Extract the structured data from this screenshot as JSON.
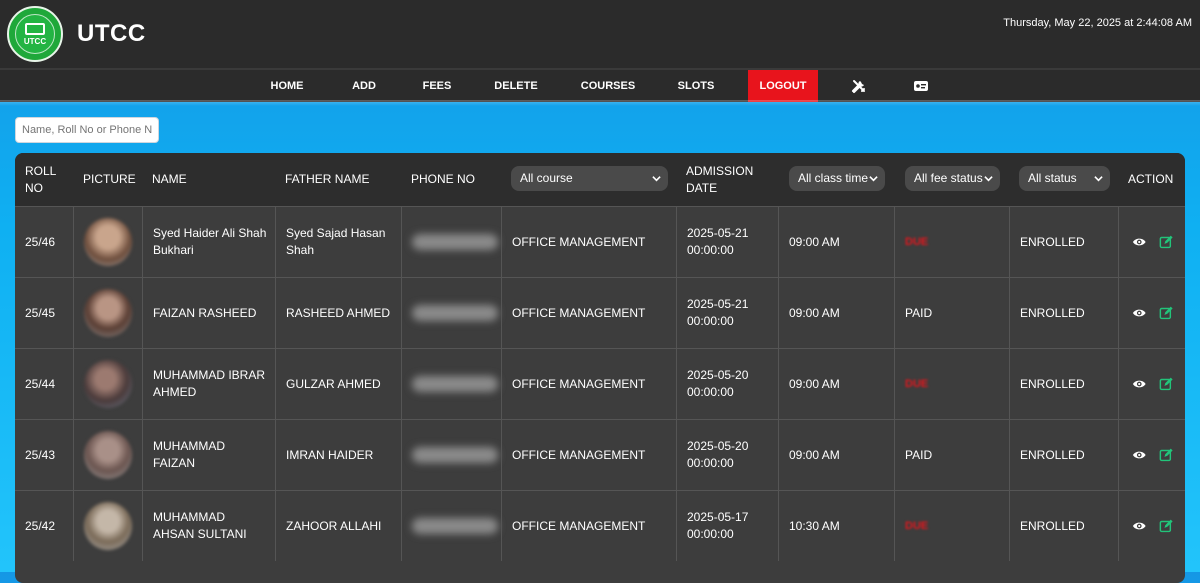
{
  "header": {
    "logo_text": "UTCC",
    "brand": "UTCC",
    "datetime": "Thursday, May 22, 2025 at 2:44:08 AM"
  },
  "nav": {
    "items": [
      "HOME",
      "ADD",
      "FEES",
      "DELETE",
      "COURSES",
      "SLOTS",
      "LOGOUT"
    ],
    "icons": [
      "tools-icon",
      "id-card-icon"
    ]
  },
  "search": {
    "placeholder": "Name, Roll No or Phone No",
    "value": ""
  },
  "table": {
    "headers": {
      "roll_no": "ROLL NO",
      "picture": "PICTURE",
      "name": "NAME",
      "father_name": "FATHER NAME",
      "phone_no": "PHONE NO",
      "course_filter": "All course",
      "admission_date": "ADMISSION DATE",
      "class_time_filter": "All class time",
      "fee_status_filter": "All fee status",
      "status_filter": "All status",
      "action": "ACTION"
    },
    "rows": [
      {
        "roll": "25/46",
        "name": "Syed Haider Ali Shah Bukhari",
        "father": "Syed Sajad Hasan Shah",
        "course": "OFFICE MANAGEMENT",
        "admission_date": "2025-05-21",
        "admission_time": "00:00:00",
        "class_time": "09:00 AM",
        "fee_status": "DUE",
        "status": "ENROLLED"
      },
      {
        "roll": "25/45",
        "name": "FAIZAN RASHEED",
        "father": "RASHEED AHMED",
        "course": "OFFICE MANAGEMENT",
        "admission_date": "2025-05-21",
        "admission_time": "00:00:00",
        "class_time": "09:00 AM",
        "fee_status": "PAID",
        "status": "ENROLLED"
      },
      {
        "roll": "25/44",
        "name": "MUHAMMAD IBRAR AHMED",
        "father": "GULZAR AHMED",
        "course": "OFFICE MANAGEMENT",
        "admission_date": "2025-05-20",
        "admission_time": "00:00:00",
        "class_time": "09:00 AM",
        "fee_status": "DUE",
        "status": "ENROLLED"
      },
      {
        "roll": "25/43",
        "name": "MUHAMMAD FAIZAN",
        "father": "IMRAN HAIDER",
        "course": "OFFICE MANAGEMENT",
        "admission_date": "2025-05-20",
        "admission_time": "00:00:00",
        "class_time": "09:00 AM",
        "fee_status": "PAID",
        "status": "ENROLLED"
      },
      {
        "roll": "25/42",
        "name": "MUHAMMAD AHSAN SULTANI",
        "father": "ZAHOOR ALLAHI",
        "course": "OFFICE MANAGEMENT",
        "admission_date": "2025-05-17",
        "admission_time": "00:00:00",
        "class_time": "10:30 AM",
        "fee_status": "DUE",
        "status": "ENROLLED"
      }
    ]
  },
  "colors": {
    "background": "#1597e5",
    "header": "#2b2b2b",
    "logout": "#e8141c",
    "due": "#e3161d",
    "edit_icon": "#22c47a"
  }
}
